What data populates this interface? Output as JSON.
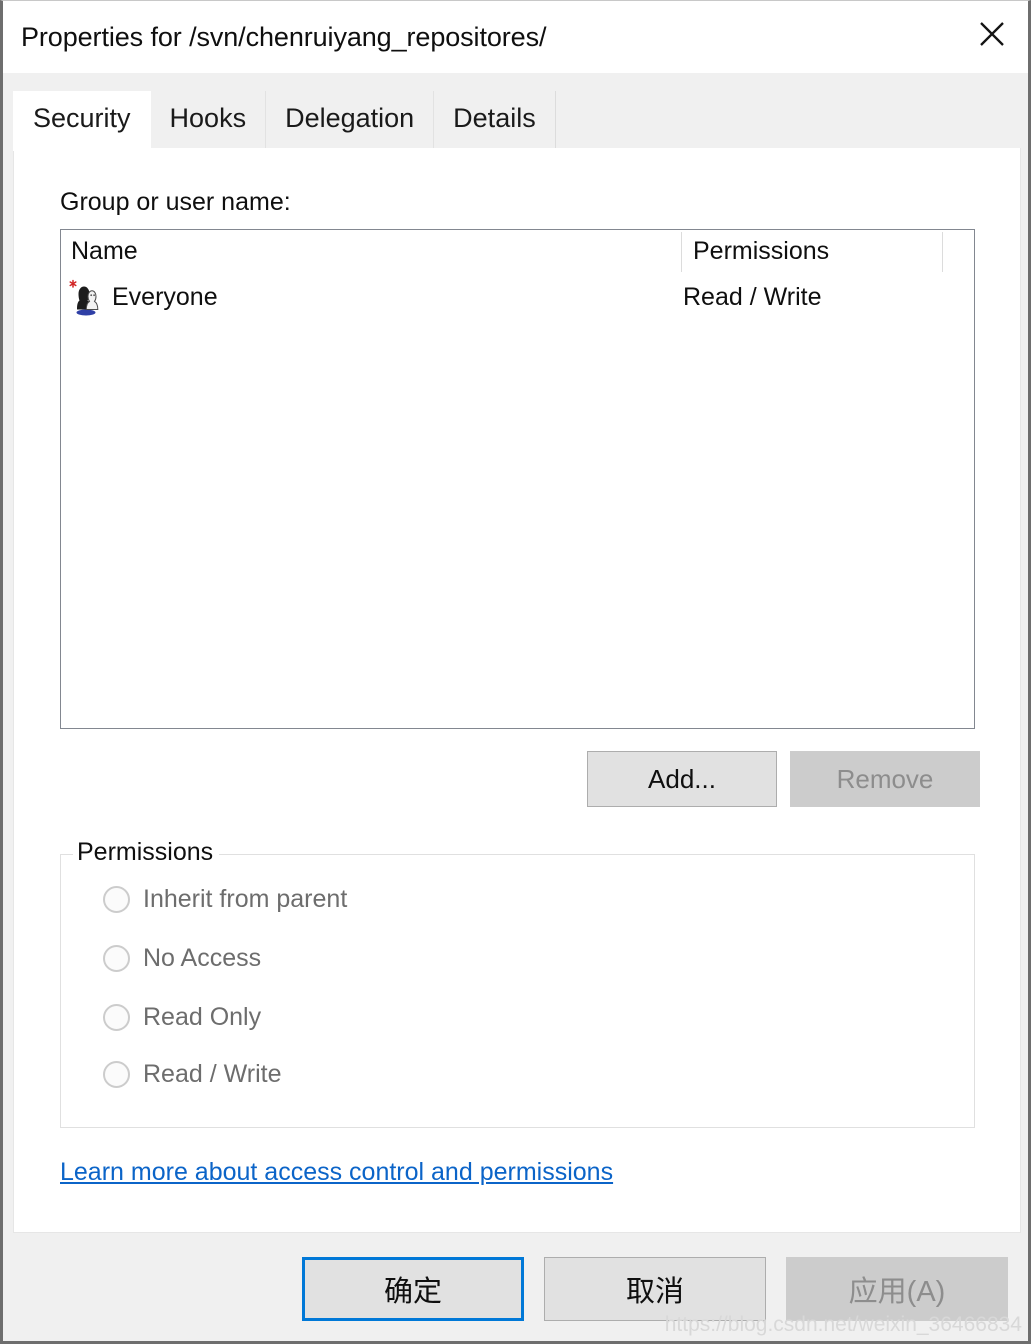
{
  "window": {
    "title": "Properties for /svn/chenruiyang_repositores/",
    "close_icon": "close-icon"
  },
  "tabs": [
    {
      "label": "Security",
      "active": true
    },
    {
      "label": "Hooks",
      "active": false
    },
    {
      "label": "Delegation",
      "active": false
    },
    {
      "label": "Details",
      "active": false
    }
  ],
  "security": {
    "group_label": "Group or user name:",
    "list": {
      "columns": [
        "Name",
        "Permissions"
      ],
      "rows": [
        {
          "icon": "everyone-user-icon",
          "name": "Everyone",
          "permissions": "Read / Write"
        }
      ]
    },
    "buttons": {
      "add": "Add...",
      "remove": "Remove"
    },
    "permissions_group": {
      "legend": "Permissions",
      "options": [
        {
          "label": "Inherit from parent",
          "selected": false
        },
        {
          "label": "No Access",
          "selected": false
        },
        {
          "label": "Read Only",
          "selected": false
        },
        {
          "label": "Read / Write",
          "selected": false
        }
      ]
    },
    "link": "Learn more about access control and permissions"
  },
  "footer": {
    "ok": "确定",
    "cancel": "取消",
    "apply": "应用(A)"
  },
  "watermark": "https://blog.csdn.net/weixin_36466834",
  "colors": {
    "accent": "#0078d7",
    "link": "#0b64c8",
    "dialog_bg": "#f0f0f0",
    "panel_bg": "#ffffff",
    "disabled_text": "#8d8d8d",
    "window_border": "#6e6e6e"
  }
}
